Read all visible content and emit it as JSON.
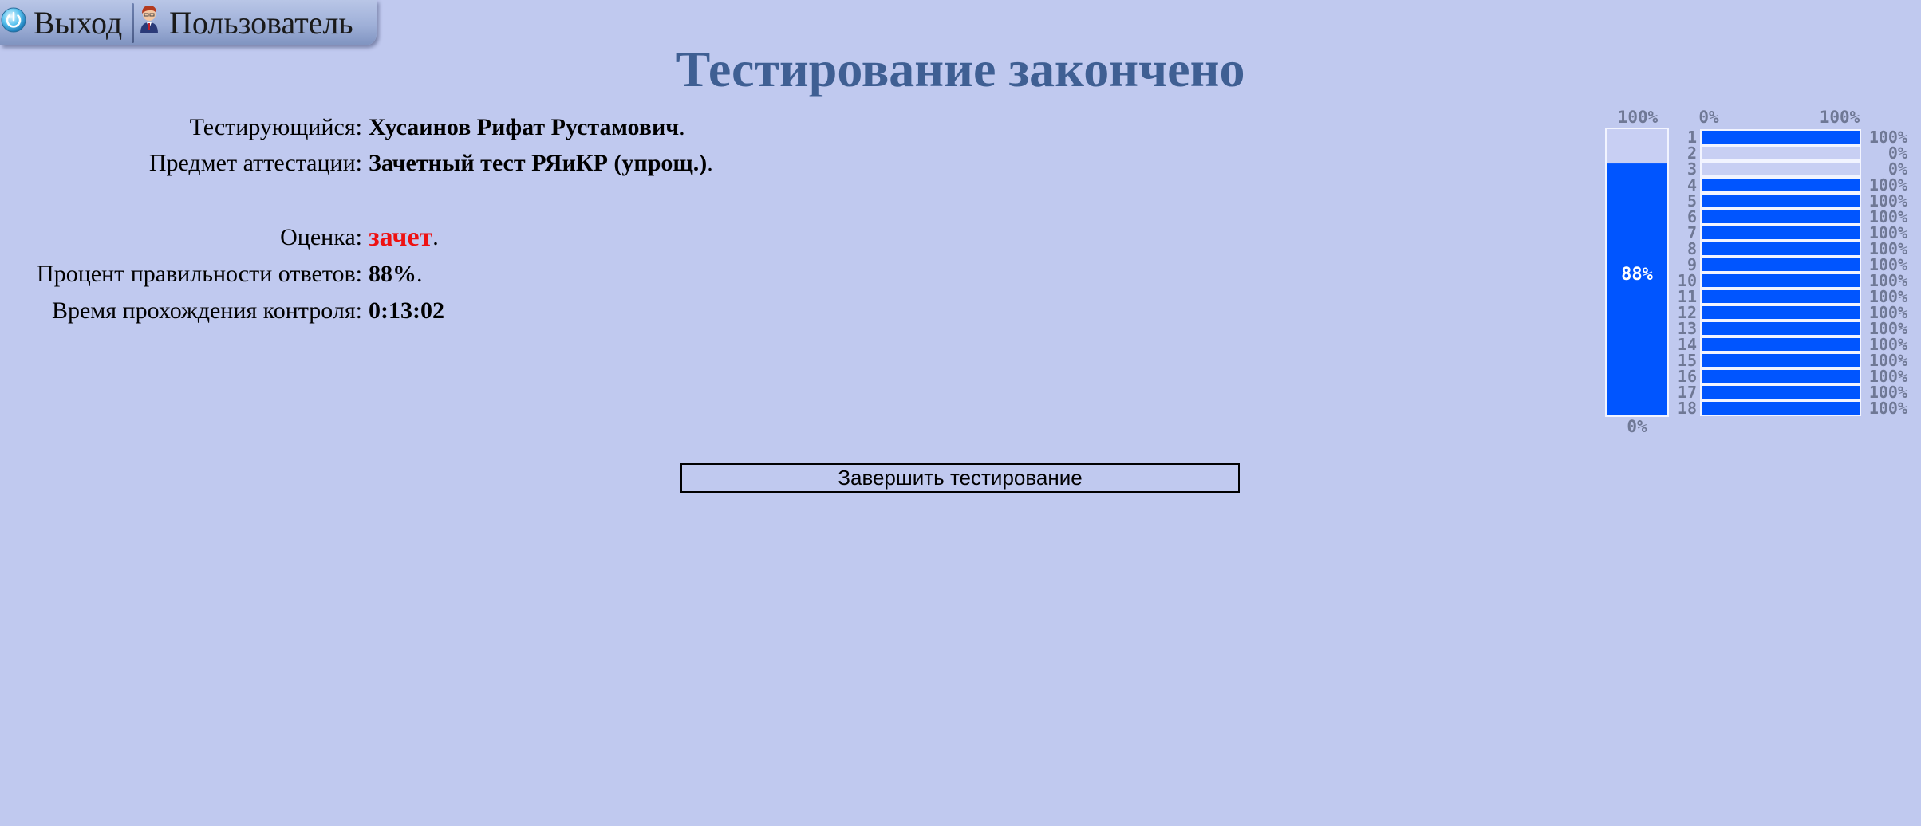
{
  "toolbar": {
    "exit_label": "Выход",
    "user_label": "Пользователь",
    "exit_icon": "power-icon",
    "user_icon": "user-avatar-icon"
  },
  "page": {
    "title": "Тестирование закончено"
  },
  "info": {
    "tester_label": "Тестирующийся:",
    "tester_value": "Хусаинов Рифат Рустамович",
    "subject_label": "Предмет аттестации:",
    "subject_value": "Зачетный тест РЯиКР (упрощ.)",
    "grade_label": "Оценка:",
    "grade_value": "зачет",
    "percent_label": "Процент правильности ответов:",
    "percent_value": "88%",
    "time_label": "Время прохождения контроля:",
    "time_value": "0:13:02",
    "period": "."
  },
  "finish_button": {
    "label": "Завершить тестирование"
  },
  "colors": {
    "background": "#c0c9ef",
    "title": "#3f5f93",
    "grade": "#ee1111",
    "bar_fill": "#0055ff",
    "bar_empty": "#c8cff3",
    "bar_border": "#f2f4ff",
    "chart_text": "#6f7895"
  },
  "chart_data": {
    "type": "bar",
    "total": {
      "value": 88,
      "value_label": "88%",
      "top_label": "100%",
      "bottom_label": "0%"
    },
    "questions": {
      "axis_min_label": "0%",
      "axis_max_label": "100%",
      "categories": [
        "1",
        "2",
        "3",
        "4",
        "5",
        "6",
        "7",
        "8",
        "9",
        "10",
        "11",
        "12",
        "13",
        "14",
        "15",
        "16",
        "17",
        "18"
      ],
      "values": [
        100,
        0,
        0,
        100,
        100,
        100,
        100,
        100,
        100,
        100,
        100,
        100,
        100,
        100,
        100,
        100,
        100,
        100
      ],
      "value_labels": [
        "100%",
        "0%",
        "0%",
        "100%",
        "100%",
        "100%",
        "100%",
        "100%",
        "100%",
        "100%",
        "100%",
        "100%",
        "100%",
        "100%",
        "100%",
        "100%",
        "100%",
        "100%"
      ]
    }
  }
}
